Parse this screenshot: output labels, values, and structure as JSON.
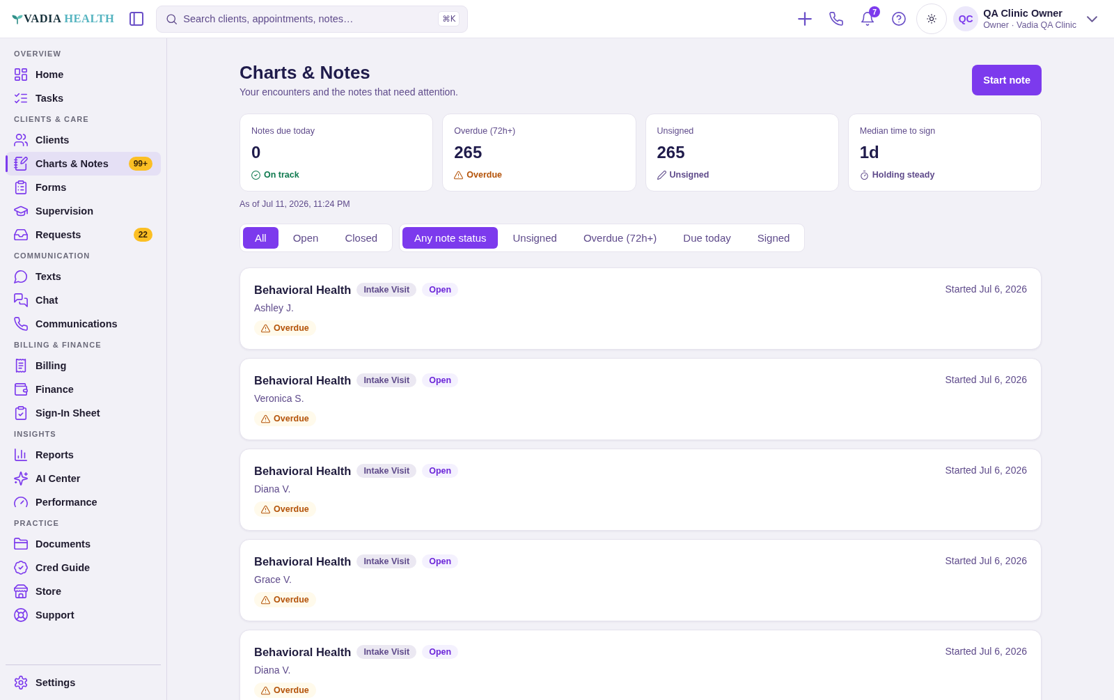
{
  "topbar": {
    "logo": {
      "words": [
        "VADIA",
        "HEALTH"
      ]
    },
    "search": {
      "placeholder": "Search clients, appointments, notes…",
      "shortcut": "⌘K"
    },
    "notifications": {
      "count": "7"
    },
    "user": {
      "initials": "QC",
      "name": "QA Clinic Owner",
      "role": "Owner · Vadia QA Clinic"
    }
  },
  "sidebar": {
    "sections": [
      {
        "label": "OVERVIEW",
        "items": [
          {
            "label": "Home",
            "selected": false
          },
          {
            "label": "Tasks",
            "selected": false
          }
        ]
      },
      {
        "label": "CLIENTS & CARE",
        "items": [
          {
            "label": "Clients",
            "selected": false
          },
          {
            "label": "Charts & Notes",
            "selected": true,
            "badge": "99+"
          },
          {
            "label": "Forms",
            "selected": false
          },
          {
            "label": "Supervision",
            "selected": false
          },
          {
            "label": "Requests",
            "selected": false,
            "badge": "22"
          }
        ]
      },
      {
        "label": "COMMUNICATION",
        "items": [
          {
            "label": "Texts",
            "selected": false
          },
          {
            "label": "Chat",
            "selected": false
          },
          {
            "label": "Communications",
            "selected": false
          }
        ]
      },
      {
        "label": "BILLING & FINANCE",
        "items": [
          {
            "label": "Billing",
            "selected": false
          },
          {
            "label": "Finance",
            "selected": false
          },
          {
            "label": "Sign-In Sheet",
            "selected": false
          }
        ]
      },
      {
        "label": "INSIGHTS",
        "items": [
          {
            "label": "Reports",
            "selected": false
          },
          {
            "label": "AI Center",
            "selected": false
          },
          {
            "label": "Performance",
            "selected": false
          }
        ]
      },
      {
        "label": "PRACTICE",
        "items": [
          {
            "label": "Documents",
            "selected": false
          },
          {
            "label": "Cred Guide",
            "selected": false
          },
          {
            "label": "Store",
            "selected": false
          },
          {
            "label": "Support",
            "selected": false
          }
        ]
      }
    ],
    "footer_items": [
      {
        "label": "Settings",
        "selected": false
      }
    ]
  },
  "page": {
    "title": "Charts & Notes",
    "subtitle": "Your encounters and the notes that need attention.",
    "primary_action": "Start note"
  },
  "stats": [
    {
      "label": "Notes due today",
      "value": "0",
      "status": {
        "kind": "on_track",
        "text": "On track"
      }
    },
    {
      "label": "Overdue (72h+)",
      "value": "265",
      "status": {
        "kind": "overdue",
        "text": "Overdue"
      }
    },
    {
      "label": "Unsigned",
      "value": "265",
      "status": {
        "kind": "unsigned",
        "text": "Unsigned"
      }
    },
    {
      "label": "Median time to sign",
      "value": "1d",
      "status": {
        "kind": "steady",
        "text": "Holding steady"
      }
    }
  ],
  "as_of": "As of Jul 11, 2026, 11:24 PM",
  "filters": {
    "encounter_status": [
      {
        "label": "All",
        "selected": true
      },
      {
        "label": "Open",
        "selected": false
      },
      {
        "label": "Closed",
        "selected": false
      }
    ],
    "note_status": [
      {
        "label": "Any note status",
        "selected": true
      },
      {
        "label": "Unsigned",
        "selected": false
      },
      {
        "label": "Overdue (72h+)",
        "selected": false
      },
      {
        "label": "Due today",
        "selected": false
      },
      {
        "label": "Signed",
        "selected": false
      }
    ]
  },
  "encounters": [
    {
      "title": "Behavioral Health",
      "tags": [
        {
          "label": "Intake Visit",
          "kind": "visit_type"
        },
        {
          "label": "Open",
          "kind": "status"
        }
      ],
      "client": "Ashley J.",
      "flags": [
        {
          "label": "Overdue",
          "kind": "overdue"
        }
      ],
      "started": "Started Jul 6, 2026"
    },
    {
      "title": "Behavioral Health",
      "tags": [
        {
          "label": "Intake Visit",
          "kind": "visit_type"
        },
        {
          "label": "Open",
          "kind": "status"
        }
      ],
      "client": "Veronica S.",
      "flags": [
        {
          "label": "Overdue",
          "kind": "overdue"
        }
      ],
      "started": "Started Jul 6, 2026"
    },
    {
      "title": "Behavioral Health",
      "tags": [
        {
          "label": "Intake Visit",
          "kind": "visit_type"
        },
        {
          "label": "Open",
          "kind": "status"
        }
      ],
      "client": "Diana V.",
      "flags": [
        {
          "label": "Overdue",
          "kind": "overdue"
        }
      ],
      "started": "Started Jul 6, 2026"
    },
    {
      "title": "Behavioral Health",
      "tags": [
        {
          "label": "Intake Visit",
          "kind": "visit_type"
        },
        {
          "label": "Open",
          "kind": "status"
        }
      ],
      "client": "Grace V.",
      "flags": [
        {
          "label": "Overdue",
          "kind": "overdue"
        }
      ],
      "started": "Started Jul 6, 2026"
    },
    {
      "title": "Behavioral Health",
      "tags": [
        {
          "label": "Intake Visit",
          "kind": "visit_type"
        },
        {
          "label": "Open",
          "kind": "status"
        }
      ],
      "client": "Diana V.",
      "flags": [
        {
          "label": "Overdue",
          "kind": "overdue"
        }
      ],
      "started": "Started Jul 6, 2026"
    }
  ]
}
